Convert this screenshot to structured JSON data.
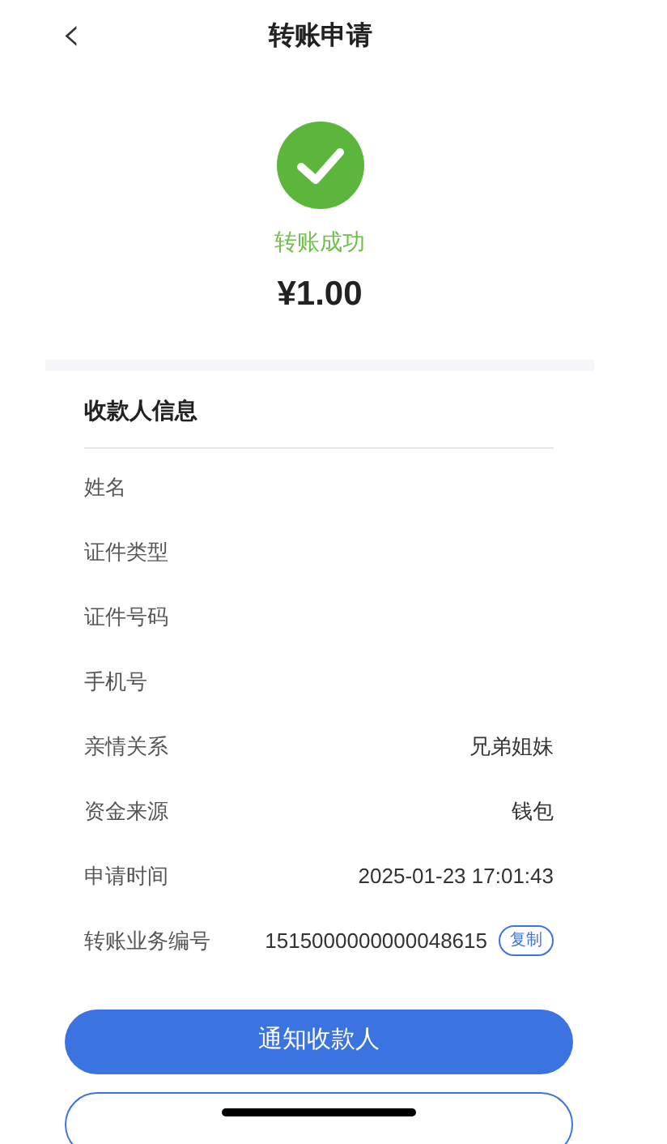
{
  "header": {
    "back_icon": "‹",
    "title": "转账申请"
  },
  "result": {
    "status": "转账成功",
    "amount": "¥1.00"
  },
  "payee": {
    "title": "收款人信息",
    "rows": [
      {
        "label": "姓名"
      },
      {
        "label": "证件类型"
      },
      {
        "label": "证件号码"
      },
      {
        "label": "手机号"
      },
      {
        "label": "亲情关系",
        "value": "兄弟姐妹"
      },
      {
        "label": "资金来源",
        "value": "钱包"
      },
      {
        "label": "申请时间",
        "value": "2025-01-23 17:01:43"
      },
      {
        "label": "转账业务编号",
        "value": "1515000000000048615",
        "action": "复制"
      }
    ]
  },
  "buttons": [
    {
      "kind": "primary",
      "label": "通知收款人"
    },
    {
      "kind": "outline"
    }
  ]
}
